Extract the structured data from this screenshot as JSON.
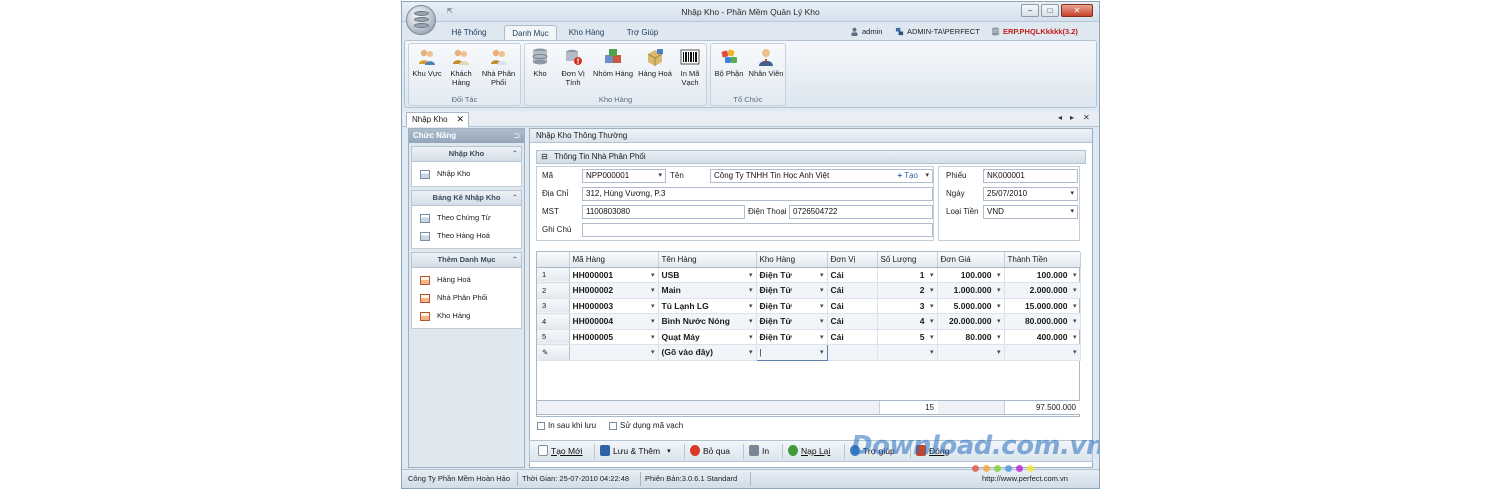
{
  "window": {
    "title": "Nhập Kho - Phần Mềm Quản Lý Kho",
    "min": "▫",
    "max": "▫",
    "close": "✕"
  },
  "ribbon_tabs": [
    "Hệ Thống",
    "Danh Mục",
    "Kho Hàng",
    "Trợ Giúp"
  ],
  "active_ribbon_tab": "Danh Mục",
  "header_info": {
    "user": "admin",
    "machine": "ADMIN-TA\\PERFECT",
    "database": "ERP.PHQLKkkkk(3.2)"
  },
  "ribbon_groups": [
    {
      "title": "Đối Tác",
      "buttons": [
        {
          "label": "Khu Vực",
          "icon": "people-icon"
        },
        {
          "label": "Khách Hàng",
          "icon": "customers-icon"
        },
        {
          "label": "Nhà Phân Phối",
          "icon": "distributors-icon"
        }
      ]
    },
    {
      "title": "Kho Hàng",
      "buttons": [
        {
          "label": "Kho",
          "icon": "database-icon"
        },
        {
          "label": "Đơn Vị Tính",
          "icon": "unit-icon"
        },
        {
          "label": "Nhóm Hàng",
          "icon": "boxes-icon"
        },
        {
          "label": "Hàng Hoá",
          "icon": "goods-icon"
        },
        {
          "label": "In Mã Vạch",
          "icon": "barcode-icon"
        }
      ]
    },
    {
      "title": "Tổ Chức",
      "buttons": [
        {
          "label": "Bộ Phận",
          "icon": "department-icon"
        },
        {
          "label": "Nhân Viên",
          "icon": "employee-icon"
        }
      ]
    }
  ],
  "doc_tab": {
    "label": "Nhập Kho",
    "close": "✕"
  },
  "left_panel": {
    "title": "Chức Năng",
    "sections": [
      {
        "title": "Nhập Kho",
        "items": [
          "Nhập Kho"
        ]
      },
      {
        "title": "Bảng Kê Nhập Kho",
        "items": [
          "Theo Chứng Từ",
          "Theo Hàng Hoá"
        ]
      },
      {
        "title": "Thêm Danh Mục",
        "items": [
          "Hàng Hoá",
          "Nhà Phân Phối",
          "Kho Hàng"
        ]
      }
    ]
  },
  "main": {
    "title": "Nhập Kho Thông Thường",
    "group_title": "Thông Tin Nhà Phân Phối",
    "form": {
      "ma_label": "Mã",
      "ma_value": "NPP000001",
      "ten_label": "Tên",
      "ten_value": "Công Ty TNHH Tin Học Anh Việt",
      "tao_label": "Tạo",
      "diachi_label": "Địa Chỉ",
      "diachi_value": "312, Hùng Vương, P.3",
      "mst_label": "MST",
      "mst_value": "1100803080",
      "dienthoai_label": "Điện Thoại",
      "dienthoai_value": "0726504722",
      "ghichu_label": "Ghi Chú",
      "ghichu_value": "",
      "phieu_label": "Phiếu",
      "phieu_value": "NK000001",
      "ngay_label": "Ngày",
      "ngay_value": "25/07/2010",
      "loaitien_label": "Loại Tiền",
      "loaitien_value": "VND"
    },
    "grid": {
      "headers": [
        "Mã Hàng",
        "Tên Hàng",
        "Kho Hàng",
        "Đơn Vị",
        "Số Lượng",
        "Đơn Giá",
        "Thành Tiền"
      ],
      "rows": [
        {
          "n": "1",
          "ma": "HH000001",
          "ten": "USB",
          "kho": "Điện Tử",
          "dv": "Cái",
          "sl": "1",
          "dg": "100.000",
          "tt": "100.000"
        },
        {
          "n": "2",
          "ma": "HH000002",
          "ten": "Main",
          "kho": "Điện Tử",
          "dv": "Cái",
          "sl": "2",
          "dg": "1.000.000",
          "tt": "2.000.000"
        },
        {
          "n": "3",
          "ma": "HH000003",
          "ten": "Tủ Lạnh LG",
          "kho": "Điện Tử",
          "dv": "Cái",
          "sl": "3",
          "dg": "5.000.000",
          "tt": "15.000.000"
        },
        {
          "n": "4",
          "ma": "HH000004",
          "ten": "Bình Nước Nóng",
          "kho": "Điện Tử",
          "dv": "Cái",
          "sl": "4",
          "dg": "20.000.000",
          "tt": "80.000.000"
        },
        {
          "n": "5",
          "ma": "HH000005",
          "ten": "Quạt Máy",
          "kho": "Điện Tử",
          "dv": "Cái",
          "sl": "5",
          "dg": "80.000",
          "tt": "400.000"
        }
      ],
      "new_row_text": "(Gõ vào đây)",
      "total_qty": "15",
      "total_amount": "97.500.000"
    },
    "checkboxes": [
      "In sau khi lưu",
      "Sử dụng mã vạch"
    ]
  },
  "toolbar": [
    {
      "label": "Tạo Mới",
      "icon": "new-doc-icon",
      "color": "#ffffff"
    },
    {
      "label": "Lưu & Thêm",
      "icon": "save-icon",
      "color": "#2e63a8"
    },
    {
      "label": "Bỏ qua",
      "icon": "cancel-icon",
      "color": "#d83a2a"
    },
    {
      "label": "In",
      "icon": "printer-icon",
      "color": "#7b8794"
    },
    {
      "label": "Nạp Lại",
      "icon": "refresh-icon",
      "color": "#3f9b3a"
    },
    {
      "label": "Trợ giúp",
      "icon": "help-icon",
      "color": "#3d7fc4"
    },
    {
      "label": "Đóng",
      "icon": "close-door-icon",
      "color": "#c4452e"
    }
  ],
  "status": {
    "company": "Công Ty Phần Mềm Hoàn Hảo",
    "time": "Thời Gian: 25-07-2010 04:22:48",
    "version": "Phiên Bản:3.0.6.1 Standard",
    "website": "http://www.perfect.com.vn"
  },
  "watermark": {
    "text": "Download.com.vn",
    "dots": [
      "#e84b3c",
      "#f5a623",
      "#7ed321",
      "#4a90e2",
      "#bd10e0",
      "#f8e71c"
    ]
  },
  "colors": {
    "accent": "#2e63a8",
    "database_text": "#c0201a"
  }
}
